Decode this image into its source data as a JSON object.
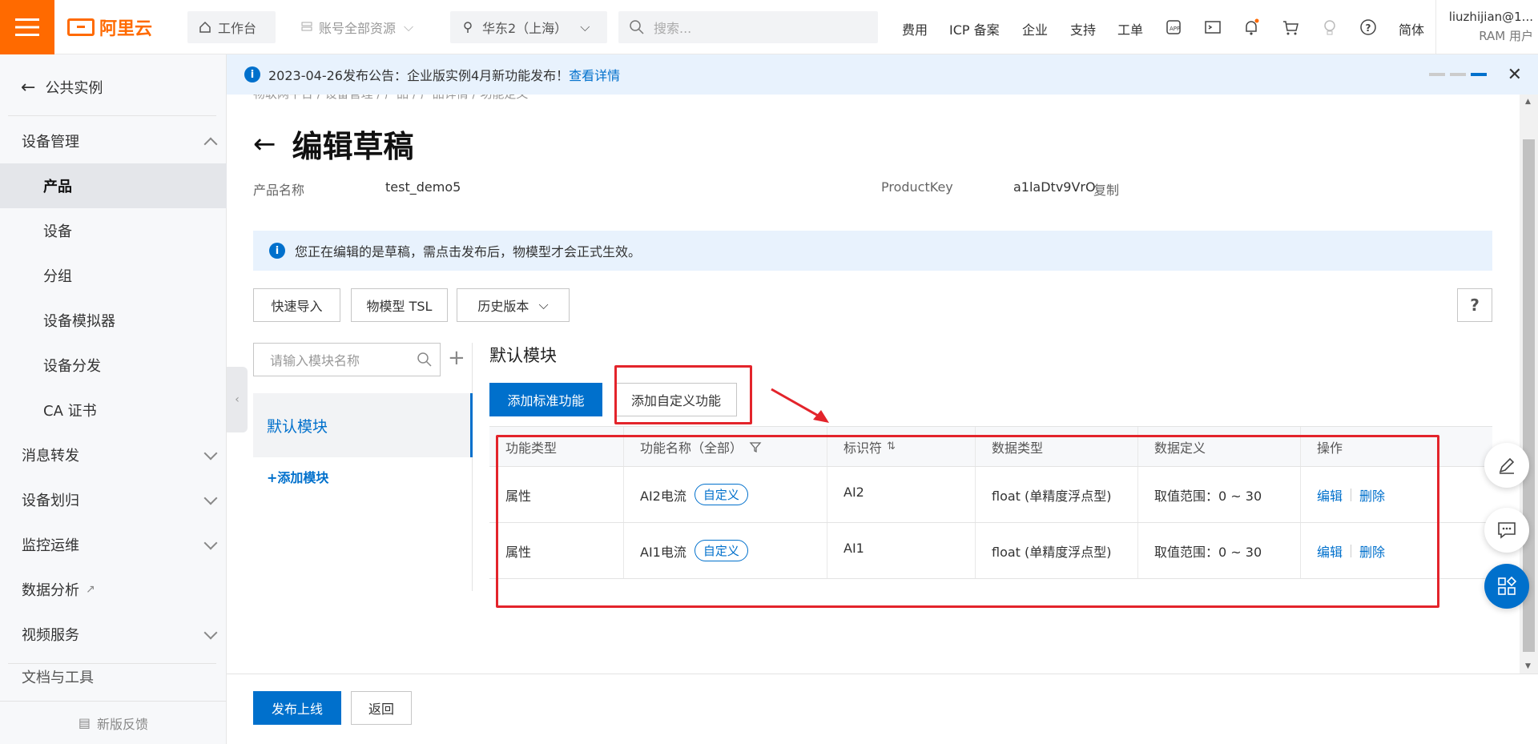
{
  "topbar": {
    "logo_text": "阿里云",
    "workbench": "工作台",
    "resource_scope": "账号全部资源",
    "region": "华东2（上海）",
    "search_placeholder": "搜索...",
    "nav": [
      "费用",
      "ICP 备案",
      "企业",
      "支持",
      "工单"
    ],
    "language": "简体",
    "user_name": "liuzhijian@1...",
    "user_role": "RAM 用户"
  },
  "sidebar": {
    "back_label": "公共实例",
    "groups": [
      {
        "label": "设备管理",
        "expanded": true
      },
      {
        "label": "消息转发"
      },
      {
        "label": "设备划归"
      },
      {
        "label": "监控运维"
      },
      {
        "label": "数据分析"
      },
      {
        "label": "视频服务"
      },
      {
        "label": "文档与工具"
      }
    ],
    "items": [
      {
        "label": "产品",
        "active": true
      },
      {
        "label": "设备"
      },
      {
        "label": "分组"
      },
      {
        "label": "设备模拟器"
      },
      {
        "label": "设备分发"
      },
      {
        "label": "CA 证书"
      }
    ],
    "feedback": "新版反馈"
  },
  "notice": {
    "text": "2023-04-26发布公告：企业版实例4月新功能发布！",
    "link": "查看详情"
  },
  "main": {
    "breadcrumb": "物联网平台 / 设备管理 / 产品 / 产品详情 / 功能定义",
    "title": "编辑草稿",
    "product_name_label": "产品名称",
    "product_name": "test_demo5",
    "product_key_label": "ProductKey",
    "product_key": "a1laDtv9VrO",
    "copy_label": "复制",
    "draft_tip": "您正在编辑的是草稿，需点击发布后，物模型才会正式生效。",
    "btn_quick_import": "快速导入",
    "btn_tsl": "物模型 TSL",
    "btn_history": "历史版本",
    "help": "?",
    "module_search_placeholder": "请输入模块名称",
    "module_active": "默认模块",
    "add_module": "+添加模块",
    "section_title": "默认模块",
    "btn_add_standard": "添加标准功能",
    "btn_add_custom": "添加自定义功能"
  },
  "table": {
    "headers": [
      "功能类型",
      "功能名称（全部）",
      "标识符",
      "数据类型",
      "数据定义",
      "操作"
    ],
    "rows": [
      {
        "type": "属性",
        "name": "AI2电流",
        "tag": "自定义",
        "identifier": "AI2",
        "datatype": "float (单精度浮点型)",
        "definition": "取值范围：0 ~ 30",
        "edit": "编辑",
        "delete": "删除"
      },
      {
        "type": "属性",
        "name": "AI1电流",
        "tag": "自定义",
        "identifier": "AI1",
        "datatype": "float (单精度浮点型)",
        "definition": "取值范围：0 ~ 30",
        "edit": "编辑",
        "delete": "删除"
      }
    ]
  },
  "footer": {
    "publish": "发布上线",
    "back": "返回"
  },
  "colors": {
    "brand_orange": "#ff6a00",
    "primary_blue": "#0070cc",
    "annotation_red": "#e3242b"
  }
}
